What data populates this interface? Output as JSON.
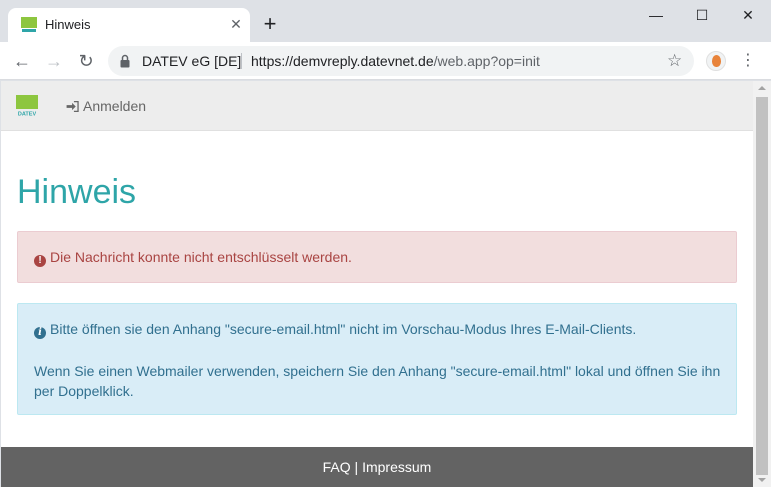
{
  "browser": {
    "tab": {
      "title": "Hinweis",
      "close_glyph": "✕",
      "favicon": "datev-logo-icon"
    },
    "new_tab_glyph": "+",
    "window_controls": {
      "minimize": "—",
      "maximize": "☐",
      "close": "✕"
    },
    "nav": {
      "back": "←",
      "forward": "→",
      "reload": "↻"
    },
    "site_identity": "DATEV eG [DE]",
    "url_host": "https://demvreply.datevnet.de",
    "url_rest": "/web.app?op=init",
    "star_glyph": "☆",
    "menu_glyph": "⋮"
  },
  "page": {
    "navbar": {
      "logo": "datev-logo-icon",
      "login_label": "Anmelden",
      "login_icon": "sign-in-icon"
    },
    "title": "Hinweis",
    "danger_alert": {
      "icon": "exclamation-circle-icon",
      "text": "Die Nachricht konnte nicht entschlüsselt werden."
    },
    "info_alert": {
      "icon": "info-circle-icon",
      "line1": "Bitte öffnen sie den Anhang \"secure-email.html\" nicht im Vorschau-Modus Ihres E-Mail-Clients.",
      "line2": "Wenn Sie einen Webmailer verwenden, speichern Sie den Anhang \"secure-email.html\" lokal und öffnen Sie ihn per Doppelklick."
    },
    "footer": {
      "faq": "FAQ",
      "separator": " | ",
      "impressum": "Impressum"
    }
  },
  "colors": {
    "title": "#2ea5a8",
    "danger_bg": "#f2dede",
    "danger_text": "#a94442",
    "info_bg": "#d9edf7",
    "info_text": "#31708f",
    "footer_bg": "#636363",
    "logo_green": "#8dc63f"
  }
}
